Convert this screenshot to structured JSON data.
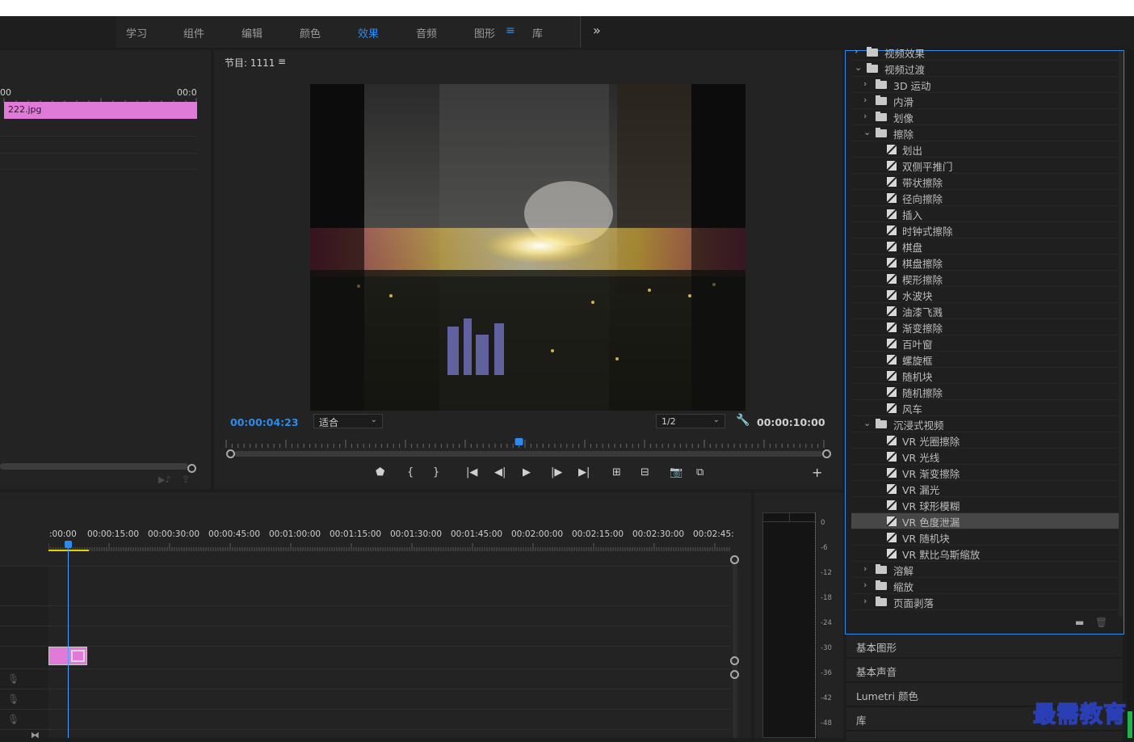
{
  "workspace_tabs": [
    "学习",
    "组件",
    "编辑",
    "颜色",
    "效果",
    "音频",
    "图形",
    "库"
  ],
  "active_tab": "效果",
  "more_label": "»",
  "source": {
    "ruler_left": "00",
    "ruler_right": "00:0",
    "clip_name": "222.jpg"
  },
  "program": {
    "title": "节目: 1111",
    "menu_icon": "≡",
    "current_tc": "00:00:04:23",
    "fit": "适合",
    "resolution": "1/2",
    "duration_tc": "00:00:10:00",
    "playhead_fraction": 0.49
  },
  "timeline": {
    "times": [
      ":00:00",
      "00:00:15:00",
      "00:00:30:00",
      "00:00:45:00",
      "00:01:00:00",
      "00:01:15:00",
      "00:01:30:00",
      "00:01:45:00",
      "00:02:00:00",
      "00:02:15:00",
      "00:02:30:00",
      "00:02:45:"
    ]
  },
  "meter": {
    "db_labels": [
      "0",
      "-6",
      "-12",
      "-18",
      "-24",
      "-30",
      "-36",
      "-42",
      "-48"
    ]
  },
  "effects": {
    "rows": [
      {
        "level": 0,
        "kind": "folder",
        "open": false,
        "label": "视频效果"
      },
      {
        "level": 0,
        "kind": "folder",
        "open": true,
        "label": "视频过渡"
      },
      {
        "level": 1,
        "kind": "folder",
        "open": false,
        "label": "3D 运动"
      },
      {
        "level": 1,
        "kind": "folder",
        "open": false,
        "label": "内滑"
      },
      {
        "level": 1,
        "kind": "folder",
        "open": false,
        "label": "划像"
      },
      {
        "level": 1,
        "kind": "folder",
        "open": true,
        "label": "擦除"
      },
      {
        "level": 2,
        "kind": "effect",
        "label": "划出"
      },
      {
        "level": 2,
        "kind": "effect",
        "label": "双侧平推门"
      },
      {
        "level": 2,
        "kind": "effect",
        "label": "带状擦除"
      },
      {
        "level": 2,
        "kind": "effect",
        "label": "径向擦除"
      },
      {
        "level": 2,
        "kind": "effect",
        "label": "插入"
      },
      {
        "level": 2,
        "kind": "effect",
        "label": "时钟式擦除"
      },
      {
        "level": 2,
        "kind": "effect",
        "label": "棋盘"
      },
      {
        "level": 2,
        "kind": "effect",
        "label": "棋盘擦除"
      },
      {
        "level": 2,
        "kind": "effect",
        "label": "楔形擦除"
      },
      {
        "level": 2,
        "kind": "effect",
        "label": "水波块"
      },
      {
        "level": 2,
        "kind": "effect",
        "label": "油漆飞溅"
      },
      {
        "level": 2,
        "kind": "effect",
        "label": "渐变擦除"
      },
      {
        "level": 2,
        "kind": "effect",
        "label": "百叶窗"
      },
      {
        "level": 2,
        "kind": "effect",
        "label": "螺旋框"
      },
      {
        "level": 2,
        "kind": "effect",
        "label": "随机块"
      },
      {
        "level": 2,
        "kind": "effect",
        "label": "随机擦除"
      },
      {
        "level": 2,
        "kind": "effect",
        "label": "风车"
      },
      {
        "level": 1,
        "kind": "folder",
        "open": true,
        "label": "沉浸式视频"
      },
      {
        "level": 2,
        "kind": "effect",
        "label": "VR 光圈擦除"
      },
      {
        "level": 2,
        "kind": "effect",
        "label": "VR 光线"
      },
      {
        "level": 2,
        "kind": "effect",
        "label": "VR 渐变擦除"
      },
      {
        "level": 2,
        "kind": "effect",
        "label": "VR 漏光"
      },
      {
        "level": 2,
        "kind": "effect",
        "label": "VR 球形模糊"
      },
      {
        "level": 2,
        "kind": "effect",
        "label": "VR 色度泄漏",
        "selected": true
      },
      {
        "level": 2,
        "kind": "effect",
        "label": "VR 随机块"
      },
      {
        "level": 2,
        "kind": "effect",
        "label": "VR 默比乌斯缩放"
      },
      {
        "level": 1,
        "kind": "folder",
        "open": false,
        "label": "溶解"
      },
      {
        "level": 1,
        "kind": "folder",
        "open": false,
        "label": "缩放"
      },
      {
        "level": 1,
        "kind": "folder",
        "open": false,
        "label": "页面剥落"
      }
    ]
  },
  "panels": [
    "基本图形",
    "基本声音",
    "Lumetri 颜色",
    "库"
  ],
  "watermark": "最需教育"
}
